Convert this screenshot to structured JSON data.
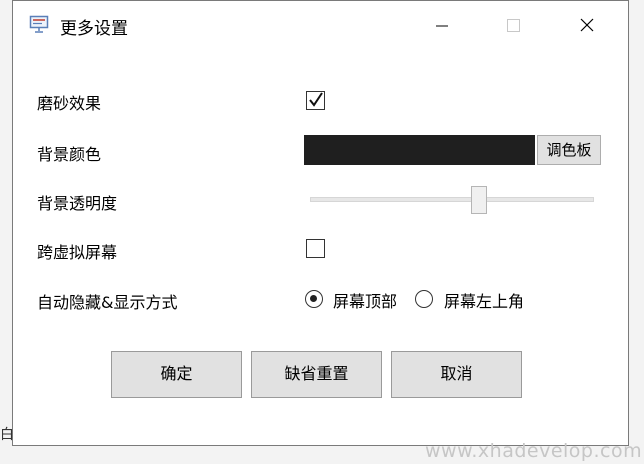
{
  "window": {
    "title": "更多设置",
    "icon": "presentation-board-icon"
  },
  "titlebar_controls": {
    "minimize_icon": "minimize-icon",
    "maximize_icon": "maximize-icon",
    "close_icon": "close-icon"
  },
  "settings": {
    "frosted_glass": {
      "label": "磨砂效果",
      "checked": true
    },
    "background_color": {
      "label": "背景颜色",
      "value": "#1f1f1f",
      "button_label": "调色板"
    },
    "background_opacity": {
      "label": "背景透明度",
      "value_fraction": 0.6
    },
    "cross_virtual_screen": {
      "label": "跨虚拟屏幕",
      "checked": false
    },
    "auto_hide": {
      "label": "自动隐藏&显示方式",
      "options": [
        {
          "label": "屏幕顶部",
          "selected": true
        },
        {
          "label": "屏幕左上角",
          "selected": false
        }
      ]
    }
  },
  "buttons": {
    "ok": "确定",
    "reset": "缺省重置",
    "cancel": "取消"
  },
  "background_fragment": "白",
  "watermark": "www.xhadevelop.com",
  "colors": {
    "window_bg": "#ffffff",
    "button_bg": "#e1e1e1",
    "swatch": "#1f1f1f",
    "watermark": "#c6c6c6"
  }
}
